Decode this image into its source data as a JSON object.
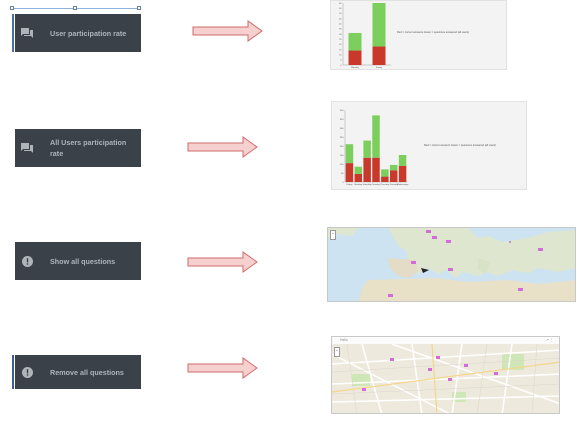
{
  "buttons": [
    {
      "label": "User participation rate",
      "icon": "forum-icon"
    },
    {
      "label": "All Users participation rate",
      "icon": "forum-icon"
    },
    {
      "label": "Show all questions",
      "icon": "info-icon"
    },
    {
      "label": "Remove all questions",
      "icon": "info-icon"
    }
  ],
  "colors": {
    "button_bg": "#3a4148",
    "button_text": "#aeb4ba",
    "arrow_fill": "#f6cfcf",
    "arrow_stroke": "#d26b6b",
    "correct": "#c8392b",
    "answered": "#7ccf5d"
  },
  "chart_data": [
    {
      "type": "bar",
      "stacked": true,
      "categories": [
        "Monday",
        "Friday"
      ],
      "series": [
        {
          "name": "Red = correct answers",
          "values": [
            14,
            18
          ]
        },
        {
          "name": "Green = questions answered",
          "values": [
            17,
            42
          ]
        }
      ],
      "yticks": [
        "60",
        "55",
        "50",
        "45",
        "40",
        "35",
        "30",
        "25",
        "20",
        "15",
        "10",
        "5",
        "0"
      ],
      "ylim": [
        0,
        60
      ],
      "annotation": "Red = correct answers Green = questions answered (all users)"
    },
    {
      "type": "bar",
      "stacked": true,
      "categories": [
        "Friday",
        "Monday",
        "Saturday",
        "Sunday",
        "Thursday",
        "Tuesday",
        "Wednesday"
      ],
      "series": [
        {
          "name": "Red = correct answers",
          "values": [
            105,
            45,
            135,
            135,
            30,
            65,
            90
          ]
        },
        {
          "name": "Green = questions answered",
          "values": [
            105,
            40,
            95,
            235,
            40,
            30,
            60
          ]
        }
      ],
      "yticks": [
        "400",
        "350",
        "300",
        "250",
        "200",
        "150",
        "100",
        "50",
        "0"
      ],
      "ylim": [
        0,
        400
      ],
      "annotation": "Red = correct answers Green = questions answered (all users)"
    }
  ],
  "map_top": {
    "zoom_plus": "+",
    "zoom_minus": "-"
  },
  "map_bottom": {
    "title": "Hello",
    "zoom_plus": "+",
    "zoom_minus": "-"
  }
}
